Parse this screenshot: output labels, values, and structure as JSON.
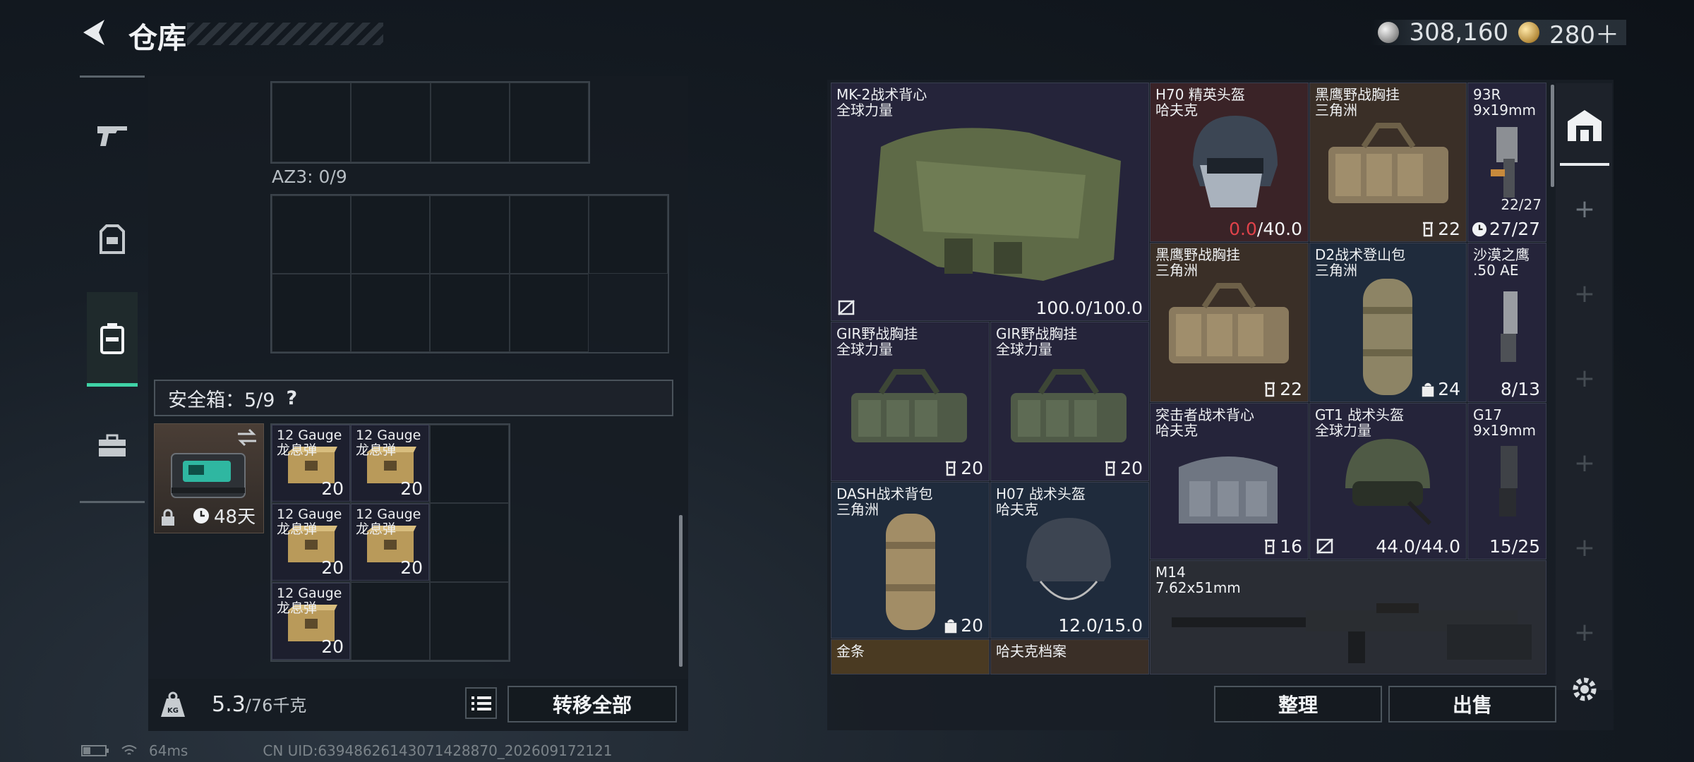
{
  "header": {
    "title": "仓库",
    "silver": "308,160",
    "gold": "280＋"
  },
  "sidebar": {
    "tabs": [
      "gun-icon",
      "armor-icon",
      "backpack-icon",
      "toolbox-icon"
    ],
    "active": 2
  },
  "left": {
    "az3_label": "AZ3: 0/9",
    "safe_label": "安全箱：5/9",
    "safe_help": "?",
    "safe_timer": "48天",
    "ammo": [
      {
        "n1": "12 Gauge",
        "n2": "龙息弹",
        "count": "20"
      },
      {
        "n1": "12 Gauge",
        "n2": "龙息弹",
        "count": "20"
      },
      {
        "n1": "12 Gauge",
        "n2": "龙息弹",
        "count": "20"
      },
      {
        "n1": "12 Gauge",
        "n2": "龙息弹",
        "count": "20"
      },
      {
        "n1": "12 Gauge",
        "n2": "龙息弹",
        "count": "20"
      }
    ],
    "weight": "5.3",
    "weight_max": "/76千克",
    "transfer_all": "转移全部"
  },
  "right": {
    "items": [
      {
        "n1": "MK-2战术背心",
        "n2": "全球力量",
        "v": "100.0/100.0"
      },
      {
        "n1": "H70 精英头盔",
        "n2": "哈夫克",
        "v_red": "0.0",
        "v": "/40.0"
      },
      {
        "n1": "黑鹰野战胸挂",
        "n2": "三角洲",
        "v": "22"
      },
      {
        "n1": "93R",
        "n2": "9x19mm",
        "v_small": "22/27",
        "v": "27/27"
      },
      {
        "n1": "黑鹰野战胸挂",
        "n2": "三角洲",
        "v": "22"
      },
      {
        "n1": "D2战术登山包",
        "n2": "三角洲",
        "v": "24"
      },
      {
        "n1": "沙漠之鹰",
        "n2": ".50 AE",
        "v": "8/13"
      },
      {
        "n1": "GIR野战胸挂",
        "n2": "全球力量",
        "v": "20"
      },
      {
        "n1": "GIR野战胸挂",
        "n2": "全球力量",
        "v": "20"
      },
      {
        "n1": "突击者战术背心",
        "n2": "哈夫克",
        "v": "16"
      },
      {
        "n1": "GT1 战术头盔",
        "n2": "全球力量",
        "v": "44.0/44.0"
      },
      {
        "n1": "G17",
        "n2": "9x19mm",
        "v": "15/25"
      },
      {
        "n1": "DASH战术背包",
        "n2": "三角洲",
        "v": "20"
      },
      {
        "n1": "H07 战术头盔",
        "n2": "哈夫克",
        "v": "12.0/15.0"
      },
      {
        "n1": "M14",
        "n2": "7.62x51mm",
        "v": ""
      },
      {
        "n1": "金条",
        "n2": "",
        "v": ""
      },
      {
        "n1": "哈夫克档案",
        "n2": "",
        "v": ""
      }
    ],
    "sort": "整理",
    "sell": "出售"
  },
  "footer": {
    "ping": "64ms",
    "uid": "CN UID:6394862614307142887​0_202609172121"
  }
}
